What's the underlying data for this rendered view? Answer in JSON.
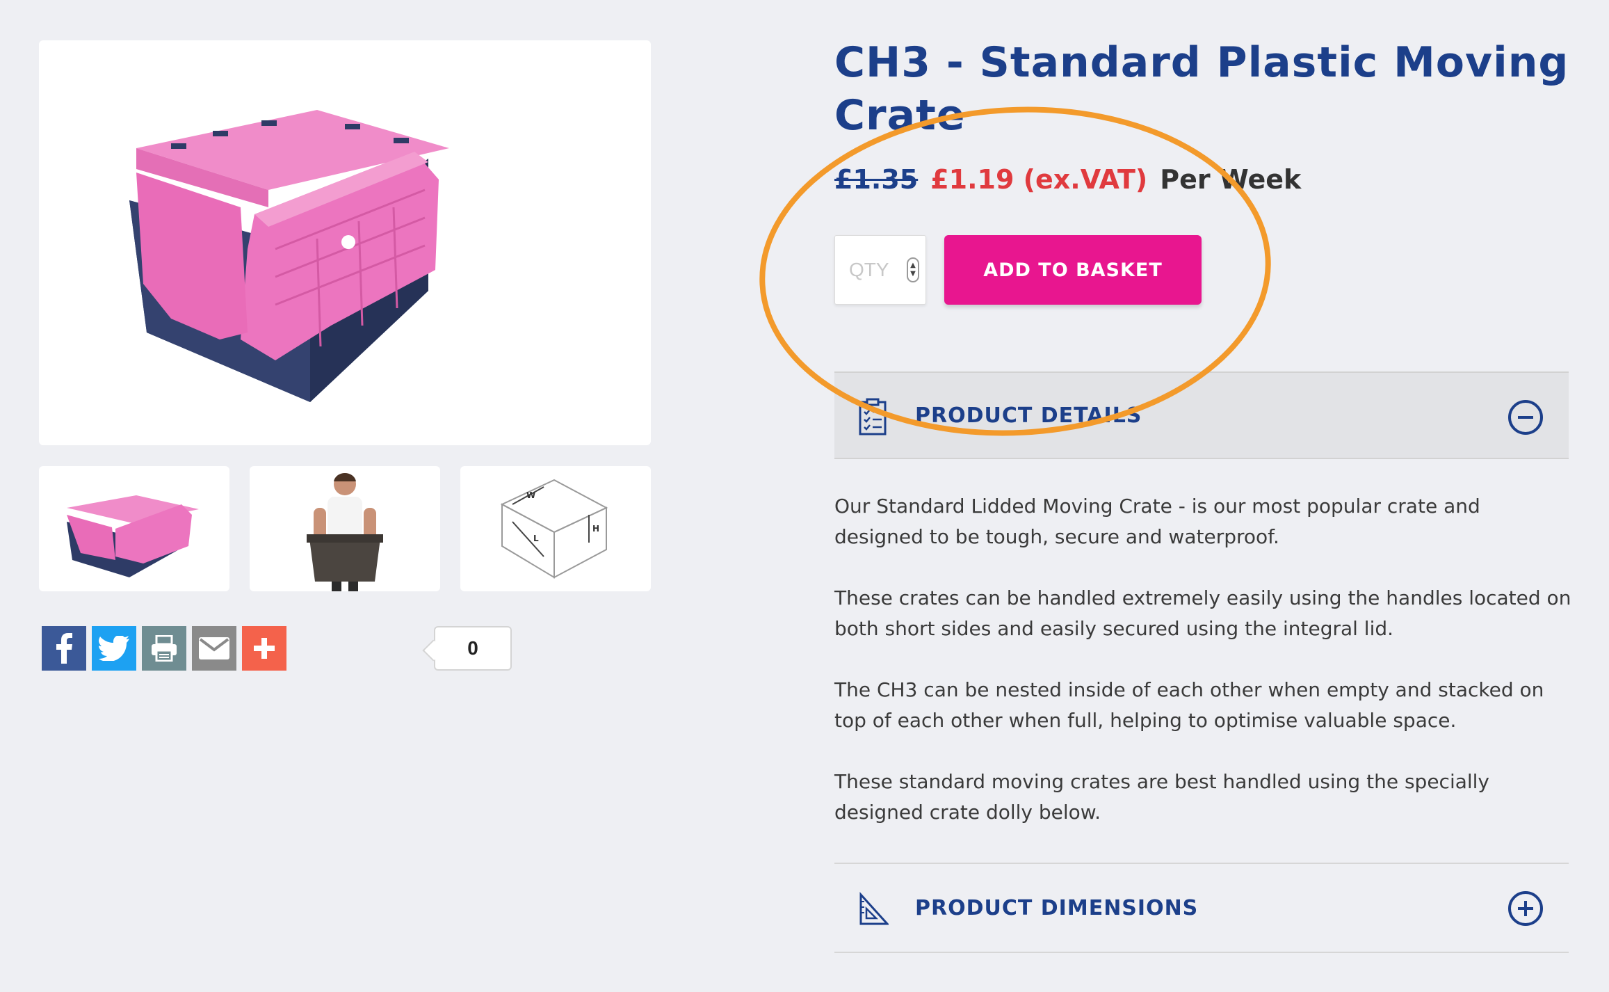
{
  "product": {
    "title": "CH3 - Standard Plastic Moving Crate",
    "price_old": "£1.35",
    "price_new": "£1.19 (ex.VAT)",
    "price_period": "Per Week"
  },
  "basket": {
    "qty_placeholder": "QTY",
    "add_label": "ADD TO BASKET"
  },
  "share": {
    "count": "0"
  },
  "accordion": {
    "details_label": "PRODUCT DETAILS",
    "dimensions_label": "PRODUCT DIMENSIONS"
  },
  "description": [
    "Our Standard Lidded Moving Crate - is our most popular crate and designed to be tough, secure and waterproof.",
    "These crates can be handled extremely easily using the handles located on both short sides and easily secured using the integral lid.",
    "The CH3 can be nested inside of each other when empty and stacked on top of each other when full, helping to optimise valuable space.",
    "These standard moving crates are best handled using the specially designed crate dolly below."
  ],
  "colors": {
    "brand_blue": "#1c3f8a",
    "accent_pink": "#e8168f",
    "sale_red": "#e03a3e",
    "annotation_orange": "#f39a2b"
  },
  "icons": [
    "facebook-icon",
    "twitter-icon",
    "print-icon",
    "email-icon",
    "plus-icon",
    "checklist-icon",
    "set-square-icon",
    "minus-circle-icon",
    "plus-circle-icon"
  ]
}
